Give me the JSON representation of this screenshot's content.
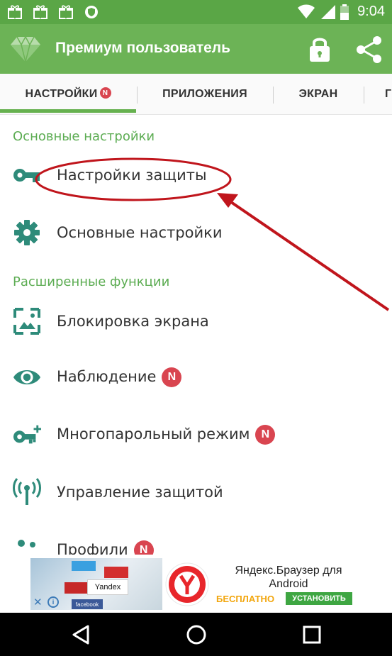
{
  "status_bar": {
    "time": "9:04",
    "icons": [
      "gift-icon",
      "gift-icon",
      "gift-icon",
      "shield-icon",
      "wifi-icon",
      "signal-icon",
      "battery-icon"
    ]
  },
  "toolbar": {
    "title": "Премиум пользователь",
    "icons": [
      "diamond-icon",
      "lock-icon",
      "share-icon"
    ]
  },
  "tabs": [
    {
      "label": "НАСТРОЙКИ",
      "badge": "N",
      "active": true
    },
    {
      "label": "ПРИЛОЖЕНИЯ"
    },
    {
      "label": "ЭКРАН"
    },
    {
      "label": "Г"
    }
  ],
  "sections": {
    "basic": "Основные настройки",
    "advanced": "Расширенные функции"
  },
  "items": [
    {
      "label": "Настройки защиты",
      "icon": "key-icon"
    },
    {
      "label": "Основные настройки",
      "icon": "gear-icon"
    },
    {
      "label": "Блокировка экрана",
      "icon": "picture-frame-icon"
    },
    {
      "label": "Наблюдение",
      "icon": "eye-icon",
      "badge": "N"
    },
    {
      "label": "Многопарольный режим",
      "icon": "key-plus-icon",
      "badge": "N"
    },
    {
      "label": "Управление защитой",
      "icon": "antenna-icon"
    },
    {
      "label": "Профили",
      "icon": "profiles-icon",
      "badge": "N"
    }
  ],
  "ad": {
    "title": "Яндекс.Браузер для Android",
    "free_label": "БЕСПЛАТНО",
    "install_label": "УСТАНОВИТЬ",
    "thumb_label": "Yandex",
    "thumb_sublabel": "facebook",
    "close_label": "✕",
    "info_label": "i"
  },
  "colors": {
    "accent": "#6cb356",
    "status_bar": "#5aa646",
    "badge": "#d94550",
    "icon": "#2e8b7a",
    "annotation": "#c0151c"
  },
  "nav": [
    "back-icon",
    "home-icon",
    "recents-icon"
  ]
}
